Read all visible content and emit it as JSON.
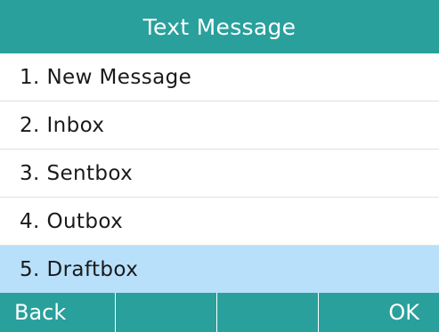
{
  "title": "Text Message",
  "menu": {
    "items": [
      {
        "label": "1. New Message"
      },
      {
        "label": "2. Inbox"
      },
      {
        "label": "3. Sentbox"
      },
      {
        "label": "4. Outbox"
      },
      {
        "label": "5. Draftbox",
        "selected": true
      }
    ]
  },
  "softkeys": {
    "back_label": "Back",
    "key2_label": "",
    "key3_label": "",
    "ok_label": "OK"
  },
  "colors": {
    "bar": "#2aa09c",
    "selected_row": "#b8e0fb",
    "bar_text": "#ffffff",
    "row_divider": "#e1e1e1"
  }
}
